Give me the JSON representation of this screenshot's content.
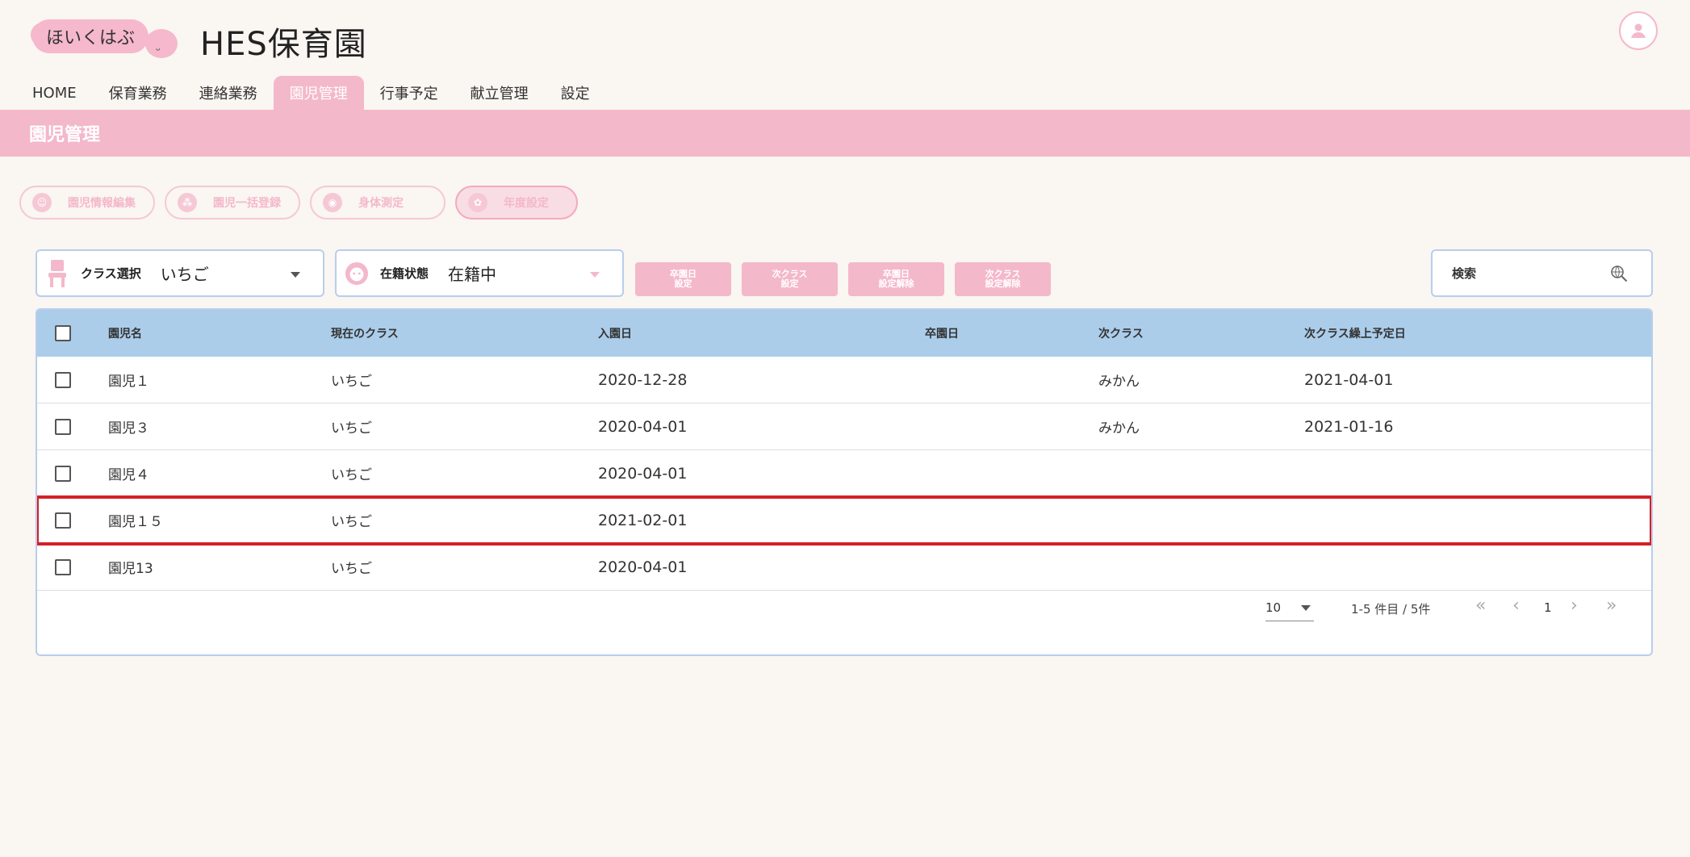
{
  "header": {
    "logo_text": "ほいくはぶ",
    "title": "HES保育園"
  },
  "nav": {
    "tabs": [
      {
        "label": "HOME"
      },
      {
        "label": "保育業務"
      },
      {
        "label": "連絡業務"
      },
      {
        "label": "園児管理"
      },
      {
        "label": "行事予定"
      },
      {
        "label": "献立管理"
      },
      {
        "label": "設定"
      }
    ],
    "active": "園児管理"
  },
  "page": {
    "title": "園児管理"
  },
  "actions": [
    {
      "label": "園児情報編集"
    },
    {
      "label": "園児一括登録"
    },
    {
      "label": "身体測定"
    },
    {
      "label": "年度設定"
    }
  ],
  "filters": {
    "class_label": "クラス選択",
    "class_value": "いちご",
    "status_label": "在籍状態",
    "status_value": "在籍中"
  },
  "mini_buttons": [
    {
      "line1": "卒園日",
      "line2": "設定"
    },
    {
      "line1": "次クラス",
      "line2": "設定"
    },
    {
      "line1": "卒園日",
      "line2": "設定解除"
    },
    {
      "line1": "次クラス",
      "line2": "設定解除"
    }
  ],
  "search": {
    "placeholder": "検索"
  },
  "table": {
    "columns": [
      "園児名",
      "現在のクラス",
      "入園日",
      "卒園日",
      "次クラス",
      "次クラス繰上予定日"
    ],
    "rows": [
      {
        "name": "園児１",
        "class": "いちご",
        "enroll": "2020-12-28",
        "grad": "",
        "next": "みかん",
        "next_date": "2021-04-01"
      },
      {
        "name": "園児３",
        "class": "いちご",
        "enroll": "2020-04-01",
        "grad": "",
        "next": "みかん",
        "next_date": "2021-01-16"
      },
      {
        "name": "園児４",
        "class": "いちご",
        "enroll": "2020-04-01",
        "grad": "",
        "next": "",
        "next_date": ""
      },
      {
        "name": "園児１５",
        "class": "いちご",
        "enroll": "2021-02-01",
        "grad": "",
        "next": "",
        "next_date": ""
      },
      {
        "name": "園児13",
        "class": "いちご",
        "enroll": "2020-04-01",
        "grad": "",
        "next": "",
        "next_date": ""
      }
    ]
  },
  "pagination": {
    "per_page": "10",
    "info": "1-5 件目 / 5件",
    "current_page": "1",
    "first": "«",
    "prev": "‹",
    "next": "›",
    "last": "»"
  },
  "colors": {
    "accent_pink": "#f4b8cb",
    "header_blue": "#abcdea",
    "highlight_red": "#d42026"
  }
}
